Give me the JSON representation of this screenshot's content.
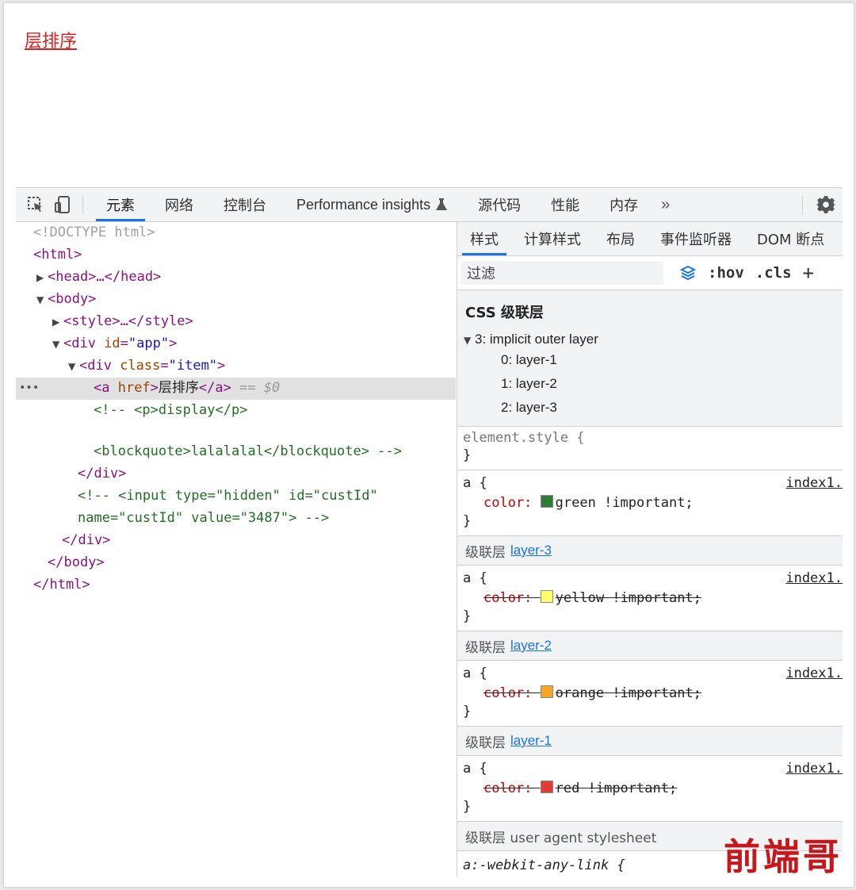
{
  "page": {
    "link_text": "层排序"
  },
  "toolbar": {
    "tabs": [
      "元素",
      "网络",
      "控制台",
      "Performance insights",
      "源代码",
      "性能",
      "内存"
    ],
    "more": "»"
  },
  "dom": {
    "doctype": "<!DOCTYPE html>",
    "html_open": "<html>",
    "head": "<head>…</head>",
    "body_open": "<body>",
    "style": "<style>…</style>",
    "div_app_tag": "<div ",
    "div_app_attr": "id",
    "div_app_val": "\"app\"",
    "div_app_close": ">",
    "div_item_tag": "<div ",
    "div_item_attr": "class",
    "div_item_val": "\"item\"",
    "div_item_close": ">",
    "a_open": "<a ",
    "a_attr": "href",
    "a_gt": ">",
    "a_text": "层排序",
    "a_close": "</a>",
    "a_eq": " == $0",
    "comment1": "<!-- <p>display</p>",
    "comment2": "<blockquote>lalalalal</blockquote> -->",
    "div_close1": "</div>",
    "comment3": "<!-- <input type=\"hidden\" id=\"custId\"",
    "comment4": "name=\"custId\" value=\"3487\"> -->",
    "div_close2": "</div>",
    "body_close": "</body>",
    "html_close": "</html>"
  },
  "styles": {
    "tabs": [
      "样式",
      "计算样式",
      "布局",
      "事件监听器",
      "DOM 断点"
    ],
    "filter_placeholder": "过滤",
    "hov": ":hov",
    "cls": ".cls",
    "plus": "+",
    "layers_title": "CSS 级联层",
    "outer_layer": "3: implicit outer layer",
    "layers": [
      "0: layer-1",
      "1: layer-2",
      "2: layer-3"
    ],
    "element_style": "element.style {",
    "close_brace": "}",
    "rules": [
      {
        "selector": "a {",
        "source": "index1.",
        "prop": "color:",
        "value": "green !important;",
        "swatch": "#2e7d32"
      },
      {
        "cascade_label": "级联层",
        "cascade_link": "layer-3",
        "selector": "a {",
        "source": "index1.",
        "prop": "color:",
        "value": "yellow !important;",
        "swatch": "#ffff66"
      },
      {
        "cascade_label": "级联层",
        "cascade_link": "layer-2",
        "selector": "a {",
        "source": "index1.",
        "prop": "color:",
        "value": "orange !important;",
        "swatch": "#f5a623"
      },
      {
        "cascade_label": "级联层",
        "cascade_link": "layer-1",
        "selector": "a {",
        "source": "index1.",
        "prop": "color:",
        "value": "red !important;",
        "swatch": "#e53935"
      }
    ],
    "ua_label": "级联层 user agent stylesheet",
    "ua_selector": "a:-webkit-any-link {"
  },
  "watermark": "前端哥"
}
